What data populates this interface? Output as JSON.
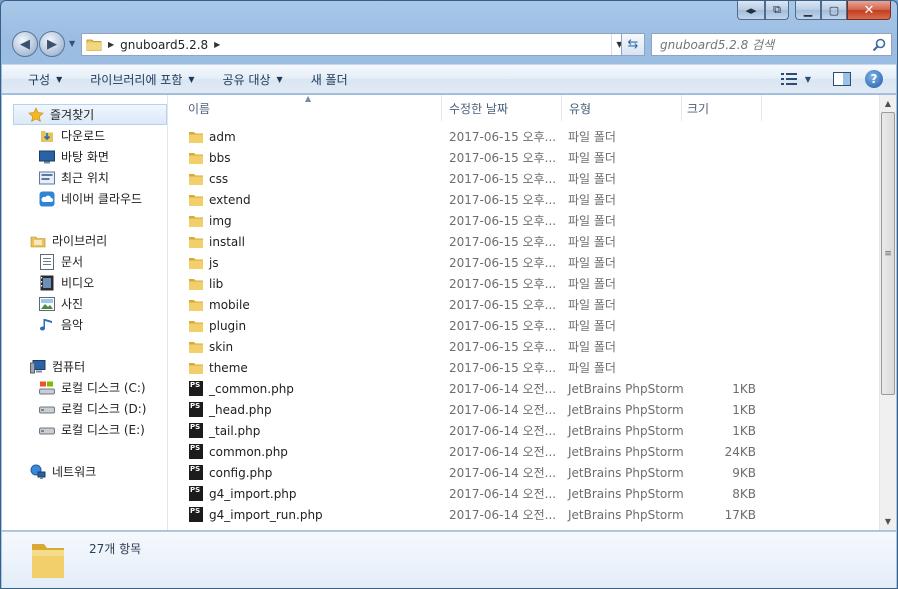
{
  "window": {
    "colors": {
      "close": "#c23d20",
      "accent": "#2f6aa8"
    }
  },
  "address": {
    "crumbs": [
      "gnuboard5.2.8"
    ],
    "search_placeholder": "gnuboard5.2.8 검색"
  },
  "toolbar": {
    "organize": "구성",
    "include_library": "라이브러리에 포함",
    "share": "공유 대상",
    "new_folder": "새 폴더"
  },
  "nav": {
    "favorites": "즐겨찾기",
    "downloads": "다운로드",
    "desktop": "바탕 화면",
    "recent": "최근 위치",
    "naver_cloud": "네이버 클라우드",
    "libraries": "라이브러리",
    "documents": "문서",
    "videos": "비디오",
    "pictures": "사진",
    "music": "음악",
    "computer": "컴퓨터",
    "disk_c": "로컬 디스크 (C:)",
    "disk_d": "로컬 디스크 (D:)",
    "disk_e": "로컬 디스크 (E:)",
    "network": "네트워크"
  },
  "columns": {
    "name": "이름",
    "date": "수정한 날짜",
    "type": "유형",
    "size": "크기"
  },
  "files": [
    {
      "name": "adm",
      "date": "2017-06-15 오후...",
      "type": "파일 폴더",
      "size": "",
      "kind": "folder"
    },
    {
      "name": "bbs",
      "date": "2017-06-15 오후...",
      "type": "파일 폴더",
      "size": "",
      "kind": "folder"
    },
    {
      "name": "css",
      "date": "2017-06-15 오후...",
      "type": "파일 폴더",
      "size": "",
      "kind": "folder"
    },
    {
      "name": "extend",
      "date": "2017-06-15 오후...",
      "type": "파일 폴더",
      "size": "",
      "kind": "folder"
    },
    {
      "name": "img",
      "date": "2017-06-15 오후...",
      "type": "파일 폴더",
      "size": "",
      "kind": "folder"
    },
    {
      "name": "install",
      "date": "2017-06-15 오후...",
      "type": "파일 폴더",
      "size": "",
      "kind": "folder"
    },
    {
      "name": "js",
      "date": "2017-06-15 오후...",
      "type": "파일 폴더",
      "size": "",
      "kind": "folder"
    },
    {
      "name": "lib",
      "date": "2017-06-15 오후...",
      "type": "파일 폴더",
      "size": "",
      "kind": "folder"
    },
    {
      "name": "mobile",
      "date": "2017-06-15 오후...",
      "type": "파일 폴더",
      "size": "",
      "kind": "folder"
    },
    {
      "name": "plugin",
      "date": "2017-06-15 오후...",
      "type": "파일 폴더",
      "size": "",
      "kind": "folder"
    },
    {
      "name": "skin",
      "date": "2017-06-15 오후...",
      "type": "파일 폴더",
      "size": "",
      "kind": "folder"
    },
    {
      "name": "theme",
      "date": "2017-06-15 오후...",
      "type": "파일 폴더",
      "size": "",
      "kind": "folder"
    },
    {
      "name": "_common.php",
      "date": "2017-06-14 오전...",
      "type": "JetBrains PhpStorm",
      "size": "1KB",
      "kind": "php"
    },
    {
      "name": "_head.php",
      "date": "2017-06-14 오전...",
      "type": "JetBrains PhpStorm",
      "size": "1KB",
      "kind": "php"
    },
    {
      "name": "_tail.php",
      "date": "2017-06-14 오전...",
      "type": "JetBrains PhpStorm",
      "size": "1KB",
      "kind": "php"
    },
    {
      "name": "common.php",
      "date": "2017-06-14 오전...",
      "type": "JetBrains PhpStorm",
      "size": "24KB",
      "kind": "php"
    },
    {
      "name": "config.php",
      "date": "2017-06-14 오전...",
      "type": "JetBrains PhpStorm",
      "size": "9KB",
      "kind": "php"
    },
    {
      "name": "g4_import.php",
      "date": "2017-06-14 오전...",
      "type": "JetBrains PhpStorm",
      "size": "8KB",
      "kind": "php"
    },
    {
      "name": "g4_import_run.php",
      "date": "2017-06-14 오전...",
      "type": "JetBrains PhpStorm",
      "size": "17KB",
      "kind": "php"
    }
  ],
  "details": {
    "count": "27개 항목"
  },
  "icons": {
    "ps_label": "PS"
  }
}
